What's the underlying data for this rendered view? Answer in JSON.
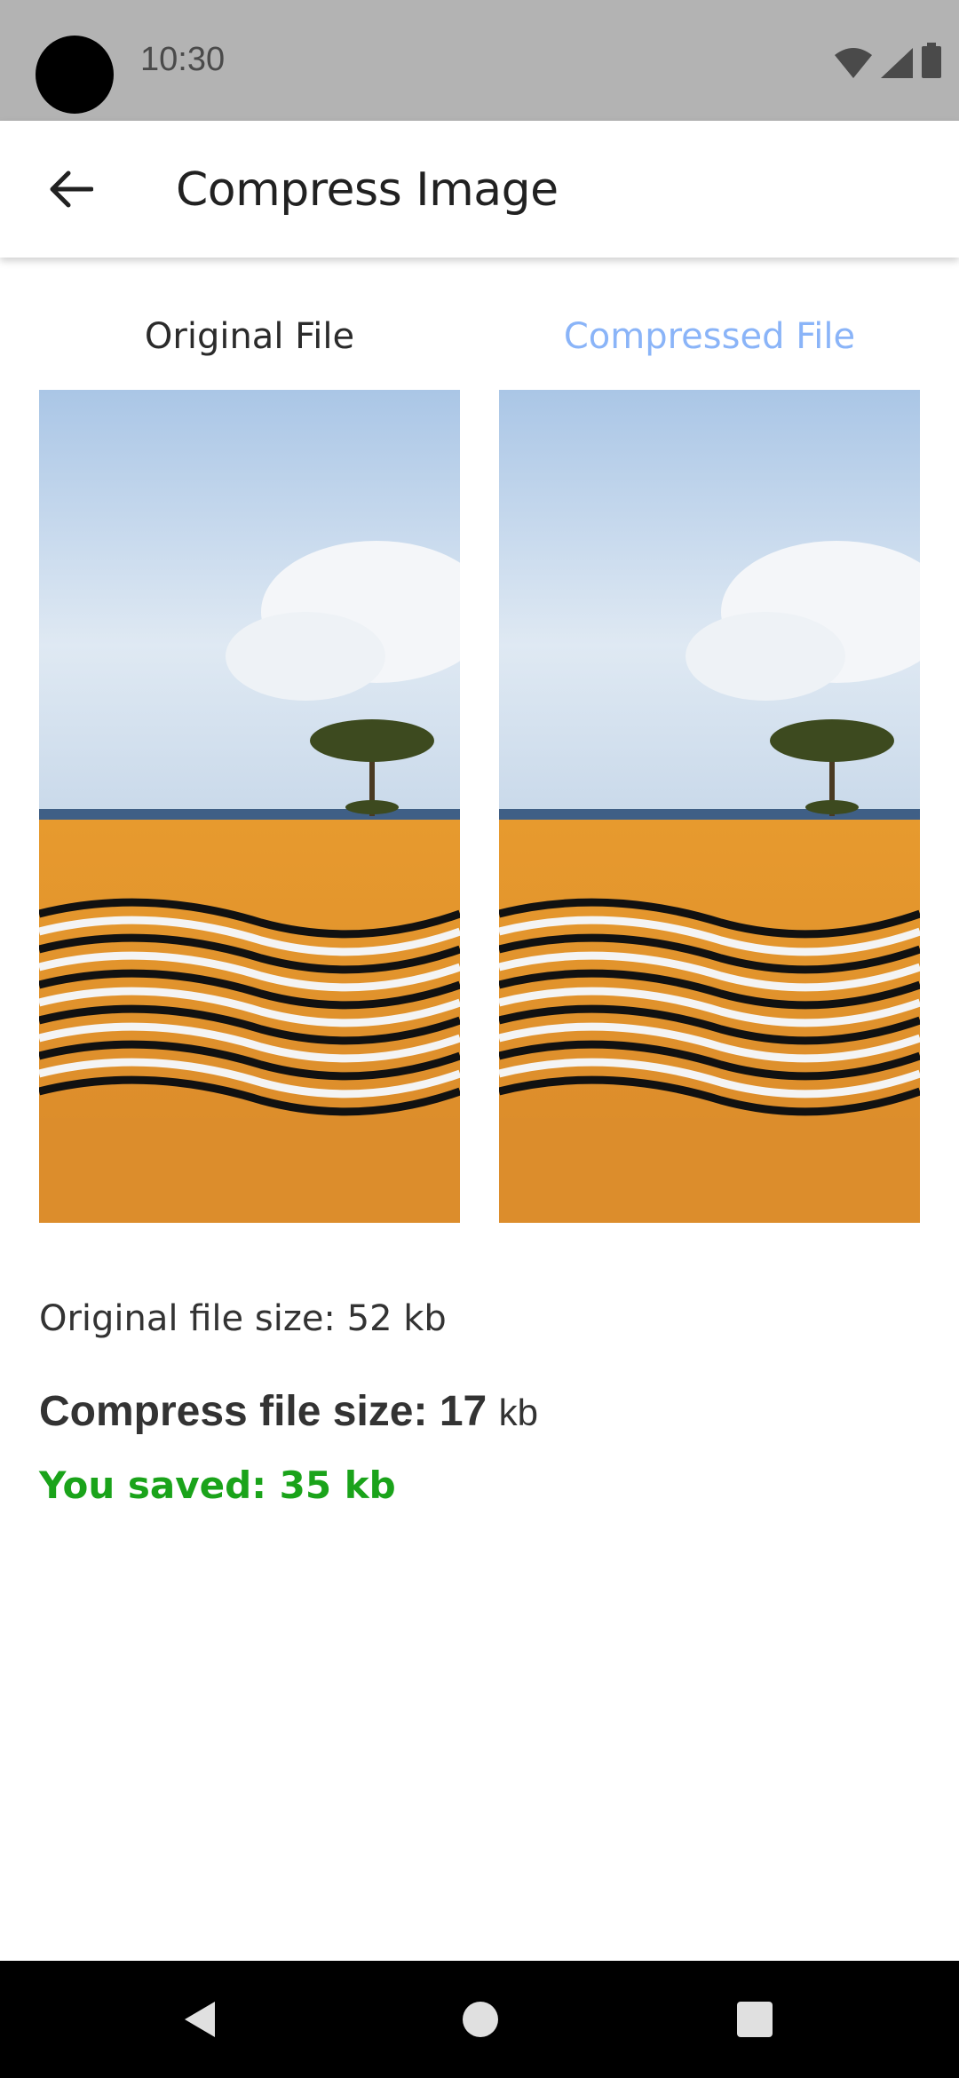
{
  "status_bar": {
    "time": "10:30",
    "icons": [
      "wifi-icon",
      "cell-signal-icon",
      "battery-icon"
    ]
  },
  "app_bar": {
    "title": "Compress Image",
    "back_icon": "arrow-left-icon"
  },
  "columns": {
    "original_label": "Original File",
    "compressed_label": "Compressed File"
  },
  "info": {
    "original_size": "Original file size: 52 kb",
    "compressed_size_label": "Compress file size: 17",
    "compressed_size_unit": "kb",
    "saved": "You saved: 35 kb"
  },
  "colors": {
    "compressed_label": "#8ab4f8",
    "saved_text": "#1aa31a",
    "status_bar": "#b3b3b3"
  },
  "nav_bar": {
    "icons": [
      "nav-back-icon",
      "nav-home-icon",
      "nav-recents-icon"
    ]
  }
}
